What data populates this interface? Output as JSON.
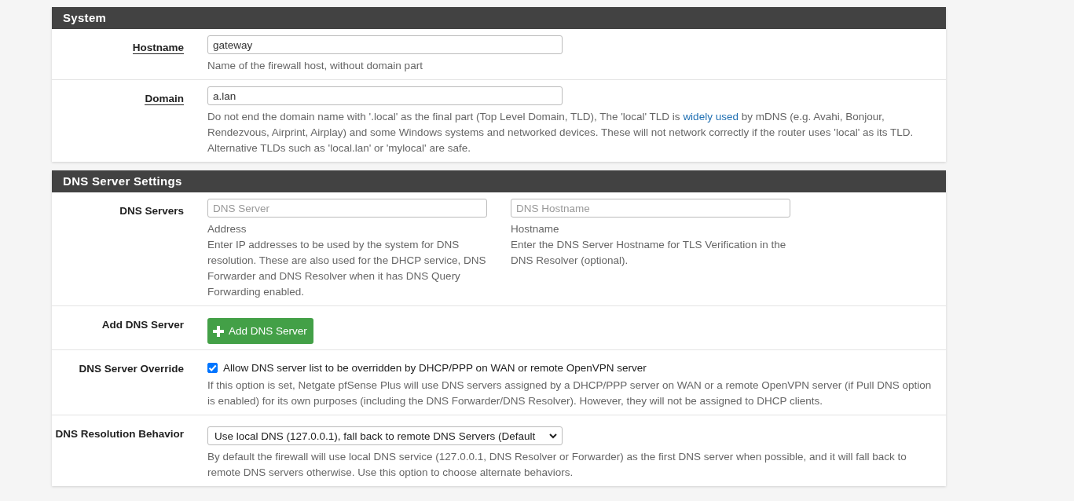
{
  "sections": [
    {
      "title": "System",
      "rows": [
        {
          "kind": "text",
          "label": "Hostname",
          "label_link": true,
          "value": "gateway",
          "help": [
            {
              "text": "Name of the firewall host, without domain part",
              "kind": "plain"
            }
          ]
        },
        {
          "kind": "text",
          "label": "Domain",
          "label_link": true,
          "value": "a.lan",
          "help": [
            {
              "text": "Do not end the domain name with '.local' as the final part (Top Level Domain, TLD), The 'local' TLD is ",
              "kind": "plain"
            },
            {
              "text": "widely used",
              "kind": "link"
            },
            {
              "text": " by mDNS (e.g. Avahi, Bonjour, Rendezvous, Airprint, Airplay) and some Windows systems and networked devices. These will not network correctly if the router uses 'local' as its TLD. Alternative TLDs such as 'local.lan' or 'mylocal' are safe.",
              "kind": "plain"
            }
          ]
        }
      ]
    },
    {
      "title": "DNS Server Settings",
      "rows": [
        {
          "kind": "pair",
          "label": "DNS Servers",
          "label_link": false,
          "columns": [
            {
              "placeholder": "DNS Server",
              "caption": "Address",
              "help": "Enter IP addresses to be used by the system for DNS resolution. These are also used for the DHCP service, DNS Forwarder and DNS Resolver when it has DNS Query Forwarding enabled."
            },
            {
              "placeholder": "DNS Hostname",
              "caption": "Hostname",
              "help": "Enter the DNS Server Hostname for TLS Verification in the DNS Resolver (optional)."
            }
          ]
        },
        {
          "kind": "button",
          "label": "Add DNS Server",
          "label_link": false,
          "button": "Add DNS Server"
        },
        {
          "kind": "checkbox",
          "label": "DNS Server Override",
          "label_link": false,
          "checked": true,
          "text": "Allow DNS server list to be overridden by DHCP/PPP on WAN or remote OpenVPN server",
          "help": [
            {
              "text": "If this option is set, Netgate pfSense Plus will use DNS servers assigned by a DHCP/PPP server on WAN or a remote OpenVPN server (if Pull DNS option is enabled) for its own purposes (including the DNS Forwarder/DNS Resolver). However, they will not be assigned to DHCP clients.",
              "kind": "plain"
            }
          ]
        },
        {
          "kind": "select",
          "label": "DNS Resolution Behavior",
          "label_link": false,
          "value": "Use local DNS (127.0.0.1), fall back to remote DNS Servers (Default",
          "help": [
            {
              "text": "By default the firewall will use local DNS service (127.0.0.1, DNS Resolver or Forwarder) as the first DNS server when possible, and it will fall back to remote DNS servers otherwise. Use this option to choose alternate behaviors.",
              "kind": "plain"
            }
          ]
        }
      ]
    }
  ]
}
